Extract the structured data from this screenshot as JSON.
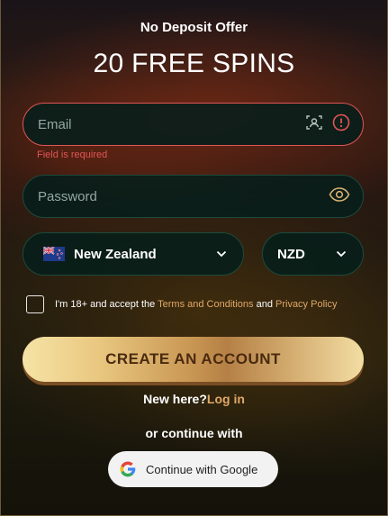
{
  "offer": {
    "label": "No Deposit Offer",
    "headline": "20 FREE SPINS"
  },
  "form": {
    "email": {
      "placeholder": "Email",
      "error": "Field is required"
    },
    "password": {
      "placeholder": "Password"
    },
    "country": {
      "selected": "New Zealand",
      "flag_icon": "new-zealand-flag-icon"
    },
    "currency": {
      "selected": "NZD"
    },
    "terms": {
      "prefix": "I'm 18+ and accept the",
      "terms_link": "Terms and Conditions",
      "and": "and",
      "privacy_link": "Privacy Policy"
    },
    "submit_label": "CREATE AN ACCOUNT"
  },
  "login": {
    "prompt": "New here?",
    "link": "Log in"
  },
  "social": {
    "divider": "or continue with",
    "google_label": "Continue with Google"
  },
  "colors": {
    "error": "#e25555",
    "link": "#e0a868",
    "field_bg": "#061e1a",
    "cta_gold": "#c89653"
  }
}
